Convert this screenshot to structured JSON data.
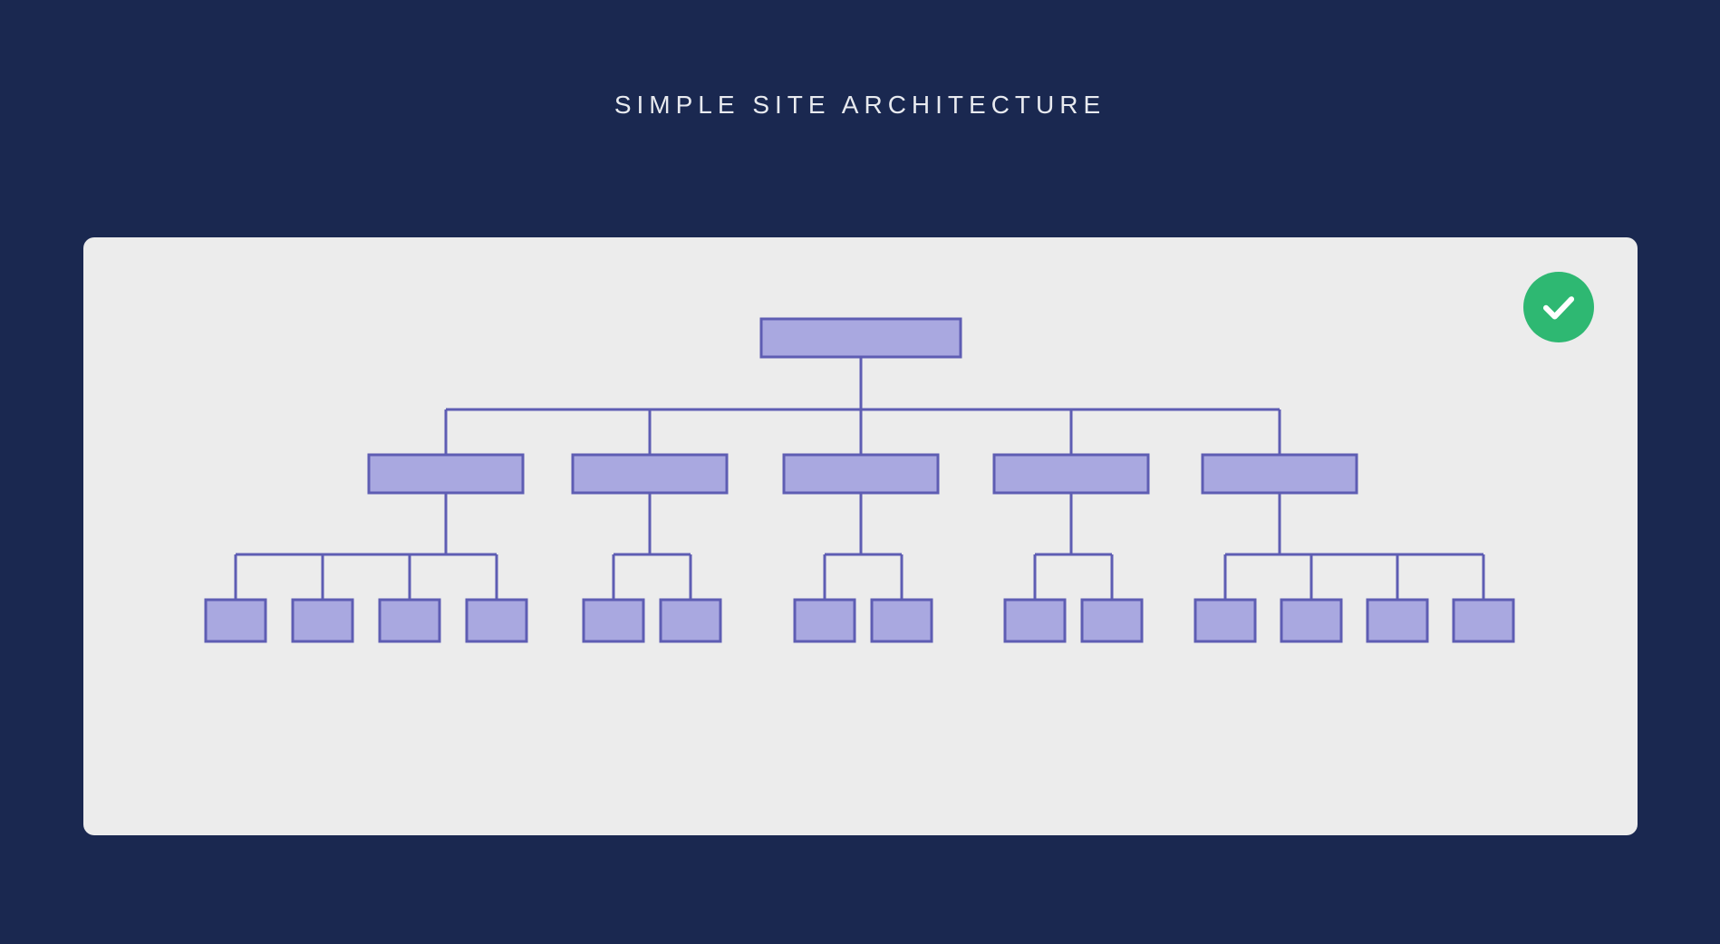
{
  "title": "SIMPLE SITE ARCHITECTURE",
  "diagram": {
    "type": "hierarchy",
    "description": "Three-level flat site architecture tree",
    "levels": [
      {
        "level": 1,
        "nodes": 1
      },
      {
        "level": 2,
        "nodes": 5
      },
      {
        "level": 3,
        "nodes_per_parent": [
          4,
          2,
          2,
          2,
          4
        ],
        "total": 14
      }
    ],
    "colors": {
      "node_fill": "#a9a8e0",
      "node_stroke": "#5e5db3",
      "connector": "#5e5db3",
      "card_bg": "#ececec",
      "page_bg": "#1a2850",
      "badge_bg": "#2eb872"
    },
    "status": "good"
  }
}
